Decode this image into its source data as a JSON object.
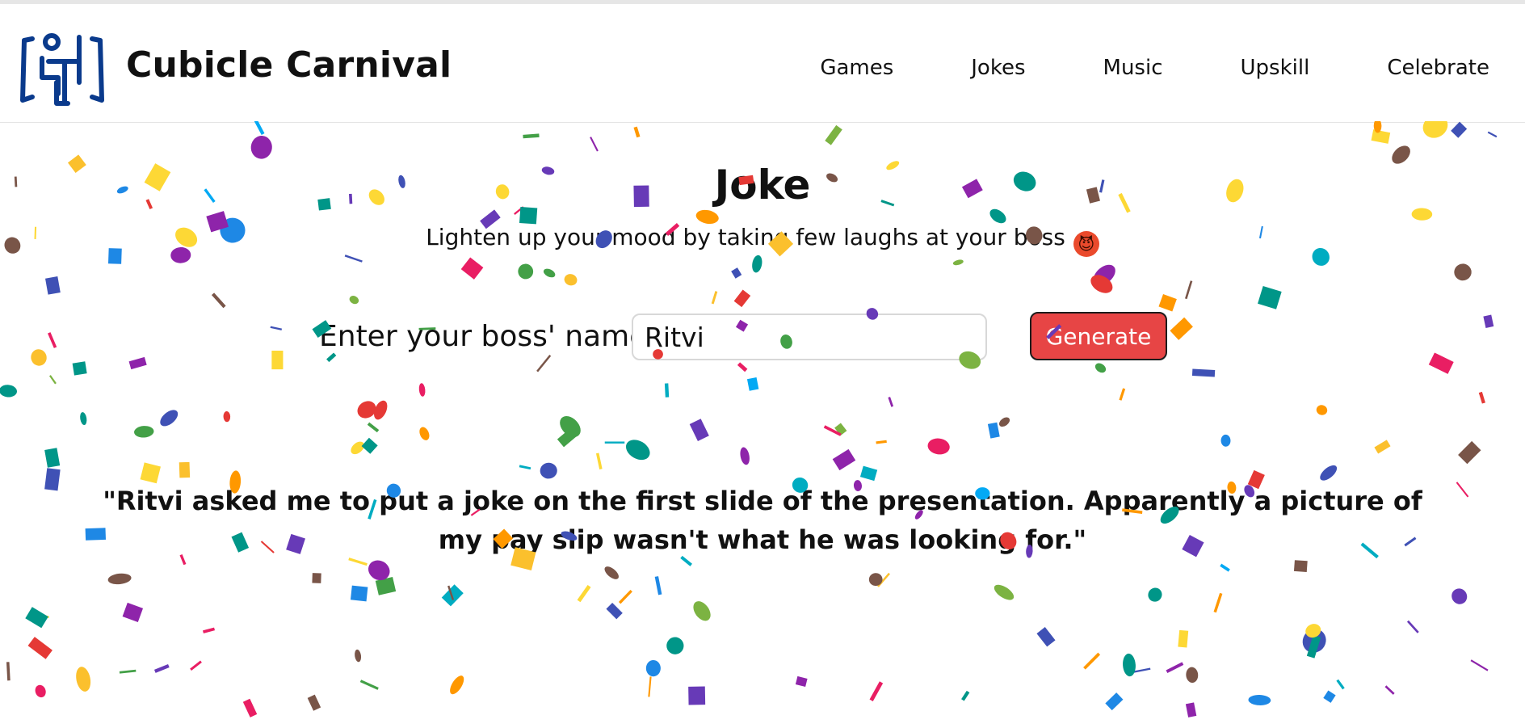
{
  "header": {
    "brand": "Cubicle Carnival",
    "logo_icon": "office-worker-icon",
    "nav": [
      "Games",
      "Jokes",
      "Music",
      "Upskill",
      "Celebrate"
    ]
  },
  "main": {
    "title": "Joke",
    "subtitle": "Lighten up your mood by taking few laughs at your boss",
    "subtitle_emoji": "😈",
    "form": {
      "label": "Enter your boss' name:",
      "input_value": "Ritvi",
      "button": "Generate"
    },
    "joke": "\"Ritvi asked me to put a joke on the first slide of the presentation. Apparently a picture of my pay slip wasn't what he was looking for.\""
  },
  "colors": {
    "accent": "#e74545",
    "logo": "#0a3a8c",
    "confetti": [
      "#e53935",
      "#8e24aa",
      "#1e88e5",
      "#43a047",
      "#fdd835",
      "#00acc1",
      "#3f51b5",
      "#e91e63",
      "#ff9800",
      "#795548",
      "#009688",
      "#7cb342",
      "#03a9f4",
      "#673ab7",
      "#fbc02d"
    ]
  }
}
